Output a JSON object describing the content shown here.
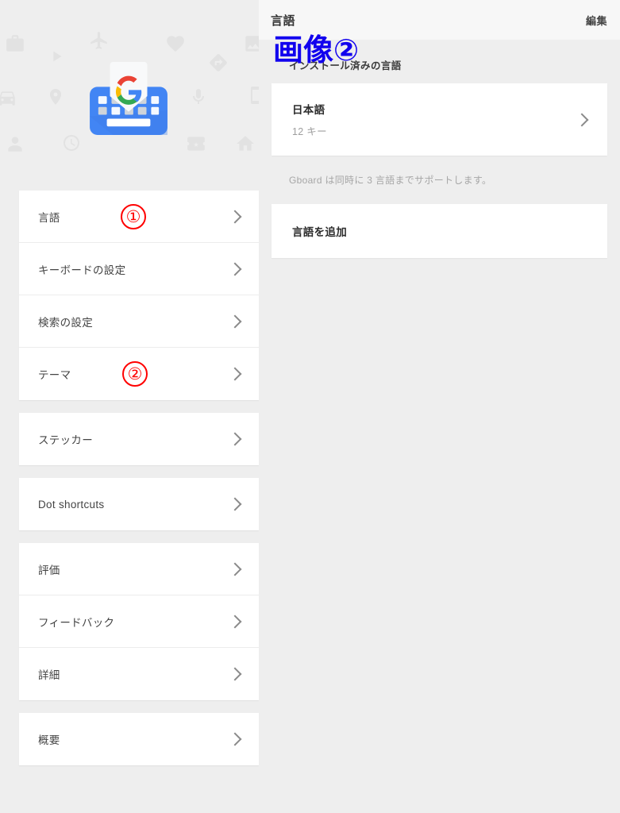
{
  "left": {
    "hero": {
      "app_icon": "gboard-logo",
      "background_icons": [
        "briefcase-icon",
        "airplane-icon",
        "heart-icon",
        "image-icon",
        "play-icon",
        "directions-icon",
        "car-icon",
        "location-pin-icon",
        "mic-icon",
        "phone-icon",
        "person-icon",
        "clock-icon",
        "ticket-icon",
        "home-icon"
      ]
    },
    "groups": [
      {
        "items": [
          {
            "label": "言語",
            "annotation": "①"
          },
          {
            "label": "キーボードの設定",
            "annotation": ""
          },
          {
            "label": "検索の設定",
            "annotation": ""
          },
          {
            "label": "テーマ",
            "annotation": "②"
          }
        ]
      },
      {
        "items": [
          {
            "label": "ステッカー",
            "annotation": ""
          }
        ]
      },
      {
        "items": [
          {
            "label": "Dot shortcuts",
            "annotation": ""
          }
        ]
      },
      {
        "items": [
          {
            "label": "評価",
            "annotation": ""
          },
          {
            "label": "フィードバック",
            "annotation": ""
          },
          {
            "label": "詳細",
            "annotation": ""
          }
        ]
      },
      {
        "items": [
          {
            "label": "概要",
            "annotation": ""
          }
        ]
      }
    ]
  },
  "right": {
    "topbar": {
      "title": "言語",
      "action": "編集"
    },
    "overlay_annotation": "画像②",
    "section_heading": "インストール済みの言語",
    "installed_languages": [
      {
        "name": "日本語",
        "sub": "12 キー"
      }
    ],
    "hint": "Gboard は同時に 3 言語までサポートします。",
    "add_language_label": "言語を追加"
  },
  "colors": {
    "annotation_red": "#ff0000",
    "annotation_blue": "#1100ee",
    "page_background": "#eeeeee",
    "card_background": "#ffffff",
    "topbar_background": "#f7f7f7",
    "gboard_blue": "#4285f4"
  }
}
